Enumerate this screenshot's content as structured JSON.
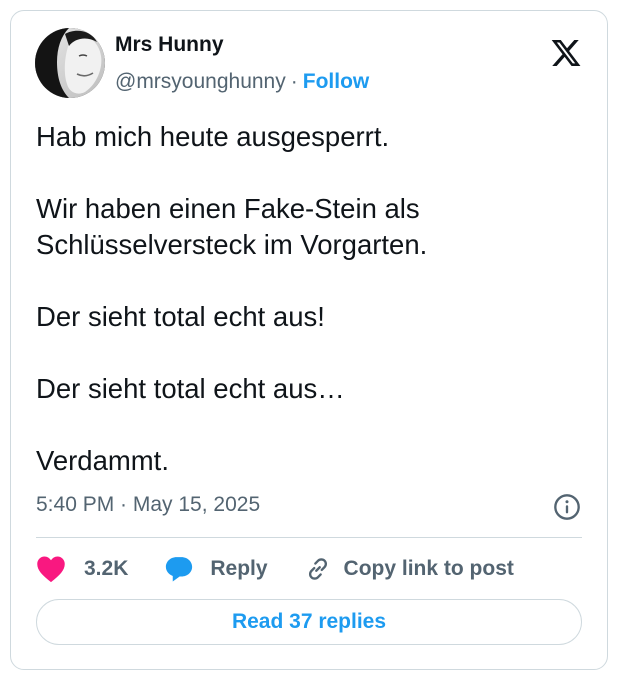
{
  "author": {
    "name": "Mrs Hunny",
    "handle": "@mrsyounghunny",
    "separator": "·",
    "follow_label": "Follow"
  },
  "tweet": {
    "paragraphs": [
      "Hab mich heute ausgesperrt.",
      "Wir haben einen Fake-Stein als Schlüsselversteck im Vorgarten.",
      "Der sieht total echt aus!",
      "Der sieht total echt aus…",
      "Verdammt."
    ],
    "timestamp": "5:40 PM · May 15, 2025"
  },
  "actions": {
    "likes_count": "3.2K",
    "reply_label": "Reply",
    "copy_link_label": "Copy link to post"
  },
  "read_replies_label": "Read 37 replies",
  "icons": {
    "platform": "x-logo-icon",
    "info": "info-icon",
    "like": "heart-icon",
    "reply": "speech-bubble-icon",
    "copy": "link-icon"
  },
  "colors": {
    "accent": "#1d9bf0",
    "like": "#f91880",
    "text_primary": "#0f1419",
    "text_secondary": "#536471",
    "border": "#cfd9de"
  }
}
